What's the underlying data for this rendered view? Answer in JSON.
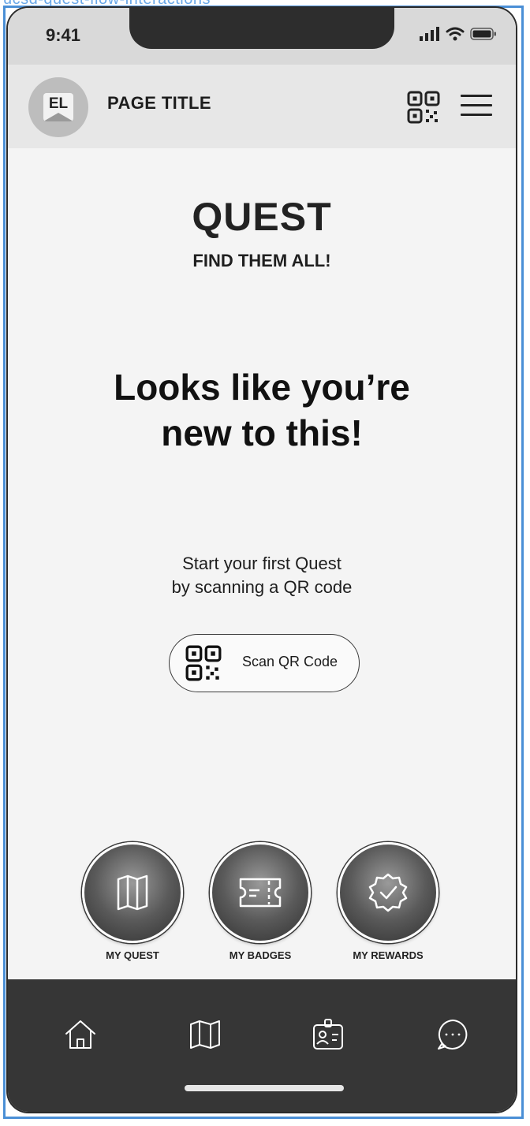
{
  "frame": {
    "label": "ucsd-quest-flow-interactions"
  },
  "status_bar": {
    "time": "9:41"
  },
  "header": {
    "avatar_initials": "EL",
    "title": "PAGE TITLE",
    "qr_icon": "qr-code-icon",
    "menu_icon": "hamburger-menu-icon"
  },
  "quest": {
    "title": "QUEST",
    "subtitle": "FIND THEM ALL!"
  },
  "empty_state": {
    "heading_line1": "Looks like you’re",
    "heading_line2": "new to this!",
    "text_line1": "Start your first Quest",
    "text_line2": "by scanning a QR code",
    "scan_button_label": "Scan QR Code"
  },
  "features": [
    {
      "label": "MY QUEST",
      "icon": "map-icon"
    },
    {
      "label": "MY BADGES",
      "icon": "ticket-icon"
    },
    {
      "label": "MY REWARDS",
      "icon": "badge-check-icon"
    }
  ],
  "tab_bar": [
    {
      "icon": "home-icon"
    },
    {
      "icon": "map-icon"
    },
    {
      "icon": "id-card-icon"
    },
    {
      "icon": "chat-icon"
    }
  ],
  "colors": {
    "background": "#f4f4f4",
    "header": "#e7e7e7",
    "status_bar": "#d9d9d9",
    "tab_bar": "#363636",
    "frame_border": "#4a8fd6"
  }
}
